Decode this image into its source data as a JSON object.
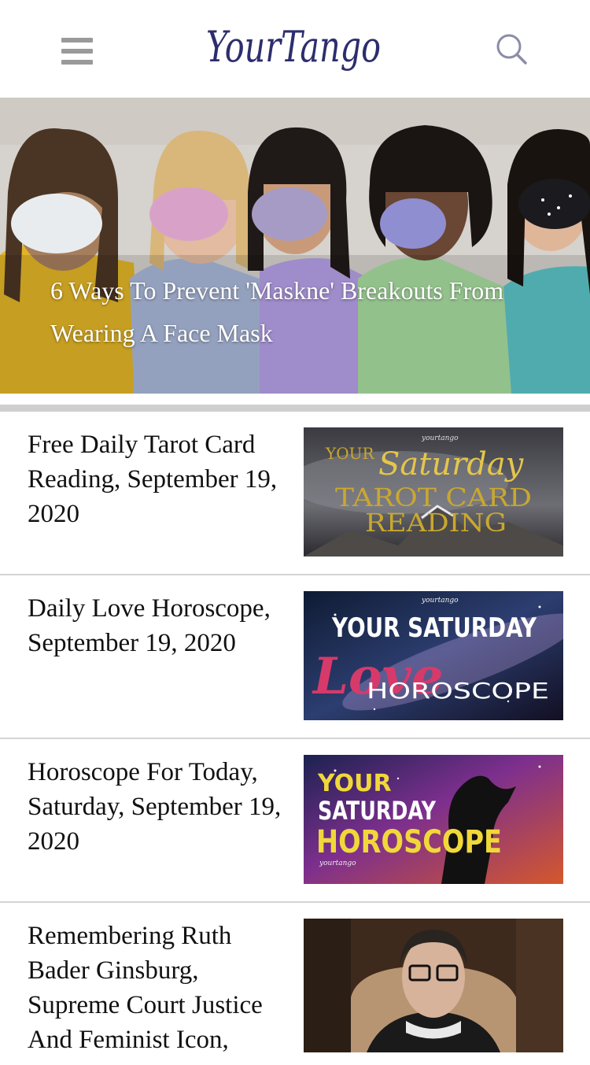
{
  "header": {
    "logo_text": "YourTango",
    "menu_icon": "hamburger-menu-icon",
    "search_icon": "search-icon"
  },
  "hero": {
    "title": "6 Ways To Prevent 'Maskne' Breakouts From Wearing A Face Mask"
  },
  "articles": [
    {
      "title": "Free Daily Tarot Card Reading, September 19, 2020",
      "thumb_lines": [
        "yourtango",
        "YOUR",
        "Saturday",
        "TAROT CARD",
        "READING"
      ]
    },
    {
      "title": "Daily Love Horoscope, September 19, 2020",
      "thumb_lines": [
        "yourtango",
        "YOUR SATURDAY",
        "Love",
        "HOROSCOPE"
      ]
    },
    {
      "title": "Horoscope For Today, Saturday, September 19, 2020",
      "thumb_lines": [
        "YOUR",
        "SATURDAY",
        "HOROSCOPE",
        "yourtango"
      ]
    },
    {
      "title": "Remembering Ruth Bader Ginsburg, Supreme Court Justice And Feminist Icon,"
    }
  ],
  "colors": {
    "logo": "#2d2d6e",
    "icon_gray": "#9a9a9a",
    "divider": "#d4d4d4"
  }
}
